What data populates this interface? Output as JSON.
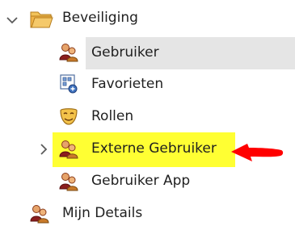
{
  "tree": {
    "beveiliging": {
      "label": "Beveiliging",
      "icon": "folder-icon",
      "expanded": true
    },
    "children": [
      {
        "label": "Gebruiker",
        "icon": "users-icon",
        "selected": true
      },
      {
        "label": "Favorieten",
        "icon": "favorites-icon"
      },
      {
        "label": "Rollen",
        "icon": "mask-icon"
      },
      {
        "label": "Externe Gebruiker",
        "icon": "users-icon",
        "highlighted": true,
        "expandable": true
      },
      {
        "label": "Gebruiker App",
        "icon": "users-icon"
      }
    ],
    "mijn_details": {
      "label": "Mijn Details",
      "icon": "users-icon"
    }
  },
  "colors": {
    "highlight": "#ffff33",
    "selection": "#e5e5e5",
    "annotation_arrow": "#ff0000",
    "folder": "#e8a63a"
  }
}
